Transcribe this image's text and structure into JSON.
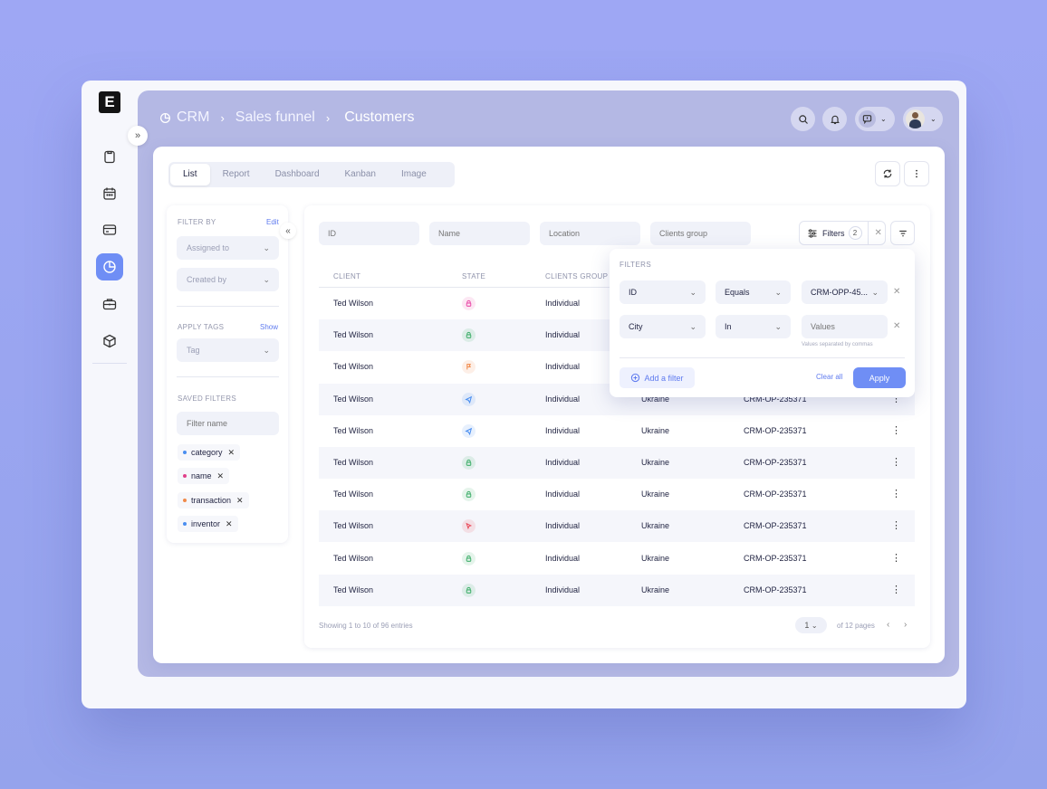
{
  "sidebar": {
    "logo": "E",
    "icons": [
      "clipboard-icon",
      "calendar-icon",
      "card-icon",
      "pie-chart-icon",
      "briefcase-icon",
      "cube-icon"
    ],
    "active_index": 3,
    "expand_glyph": "»"
  },
  "header": {
    "breadcrumb": [
      "CRM",
      "Sales funnel",
      "Customers"
    ],
    "separator": "›"
  },
  "tabs": [
    "List",
    "Report",
    "Dashboard",
    "Kanban",
    "Image"
  ],
  "active_tab": "List",
  "filter_panel": {
    "filter_by_label": "FILTER BY",
    "edit_link": "Edit",
    "assigned_to": "Assigned to",
    "created_by": "Created by",
    "apply_tags_label": "APPLY TAGS",
    "show_link": "Show",
    "tag_placeholder": "Tag",
    "saved_filters_label": "SAVED FILTERS",
    "filter_name_placeholder": "Filter name",
    "chips": [
      {
        "label": "category",
        "color": "#4a8ef0"
      },
      {
        "label": "name",
        "color": "#e0408a"
      },
      {
        "label": "transaction",
        "color": "#f08a4a"
      },
      {
        "label": "inventor",
        "color": "#4a8ef0"
      }
    ],
    "collapse_glyph": "«"
  },
  "search": {
    "id_placeholder": "ID",
    "name_placeholder": "Name",
    "location_placeholder": "Location",
    "clients_group_placeholder": "Clients group",
    "filters_label": "Filters",
    "filters_count": "2"
  },
  "table": {
    "headers": [
      "CLIENT",
      "STATE",
      "CLIENTS GROUP"
    ],
    "rows": [
      {
        "client": "Ted Wilson",
        "state": "lock",
        "state_color": "#e94aa8",
        "group": "Individual",
        "country": "",
        "id": ""
      },
      {
        "client": "Ted Wilson",
        "state": "lock",
        "state_color": "#3fae6a",
        "group": "Individual",
        "country": "",
        "id": ""
      },
      {
        "client": "Ted Wilson",
        "state": "flag",
        "state_color": "#f08a4a",
        "group": "Individual",
        "country": "",
        "id": ""
      },
      {
        "client": "Ted Wilson",
        "state": "send",
        "state_color": "#4a8ef0",
        "group": "Individual",
        "country": "Ukraine",
        "id": "CRM-OP-235371"
      },
      {
        "client": "Ted Wilson",
        "state": "send",
        "state_color": "#4a8ef0",
        "group": "Individual",
        "country": "Ukraine",
        "id": "CRM-OP-235371"
      },
      {
        "client": "Ted Wilson",
        "state": "lock",
        "state_color": "#3fae6a",
        "group": "Individual",
        "country": "Ukraine",
        "id": "CRM-OP-235371"
      },
      {
        "client": "Ted Wilson",
        "state": "lock",
        "state_color": "#3fae6a",
        "group": "Individual",
        "country": "Ukraine",
        "id": "CRM-OP-235371"
      },
      {
        "client": "Ted Wilson",
        "state": "cursor",
        "state_color": "#e94a5a",
        "group": "Individual",
        "country": "Ukraine",
        "id": "CRM-OP-235371"
      },
      {
        "client": "Ted Wilson",
        "state": "lock",
        "state_color": "#3fae6a",
        "group": "Individual",
        "country": "Ukraine",
        "id": "CRM-OP-235371"
      },
      {
        "client": "Ted Wilson",
        "state": "lock",
        "state_color": "#3fae6a",
        "group": "Individual",
        "country": "Ukraine",
        "id": "CRM-OP-235371"
      }
    ]
  },
  "footer": {
    "showing": "Showing 1 to 10 of 96 entries",
    "page": "1",
    "of_pages": "of 12 pages"
  },
  "filters_popup": {
    "title": "FILTERS",
    "rows": [
      {
        "field": "ID",
        "operator": "Equals",
        "value": "CRM-OPP-45..."
      },
      {
        "field": "City",
        "operator": "In",
        "value": "Values"
      }
    ],
    "hint": "Values separated by commas",
    "add_filter": "Add a filter",
    "clear_all": "Clear all",
    "apply": "Apply"
  }
}
